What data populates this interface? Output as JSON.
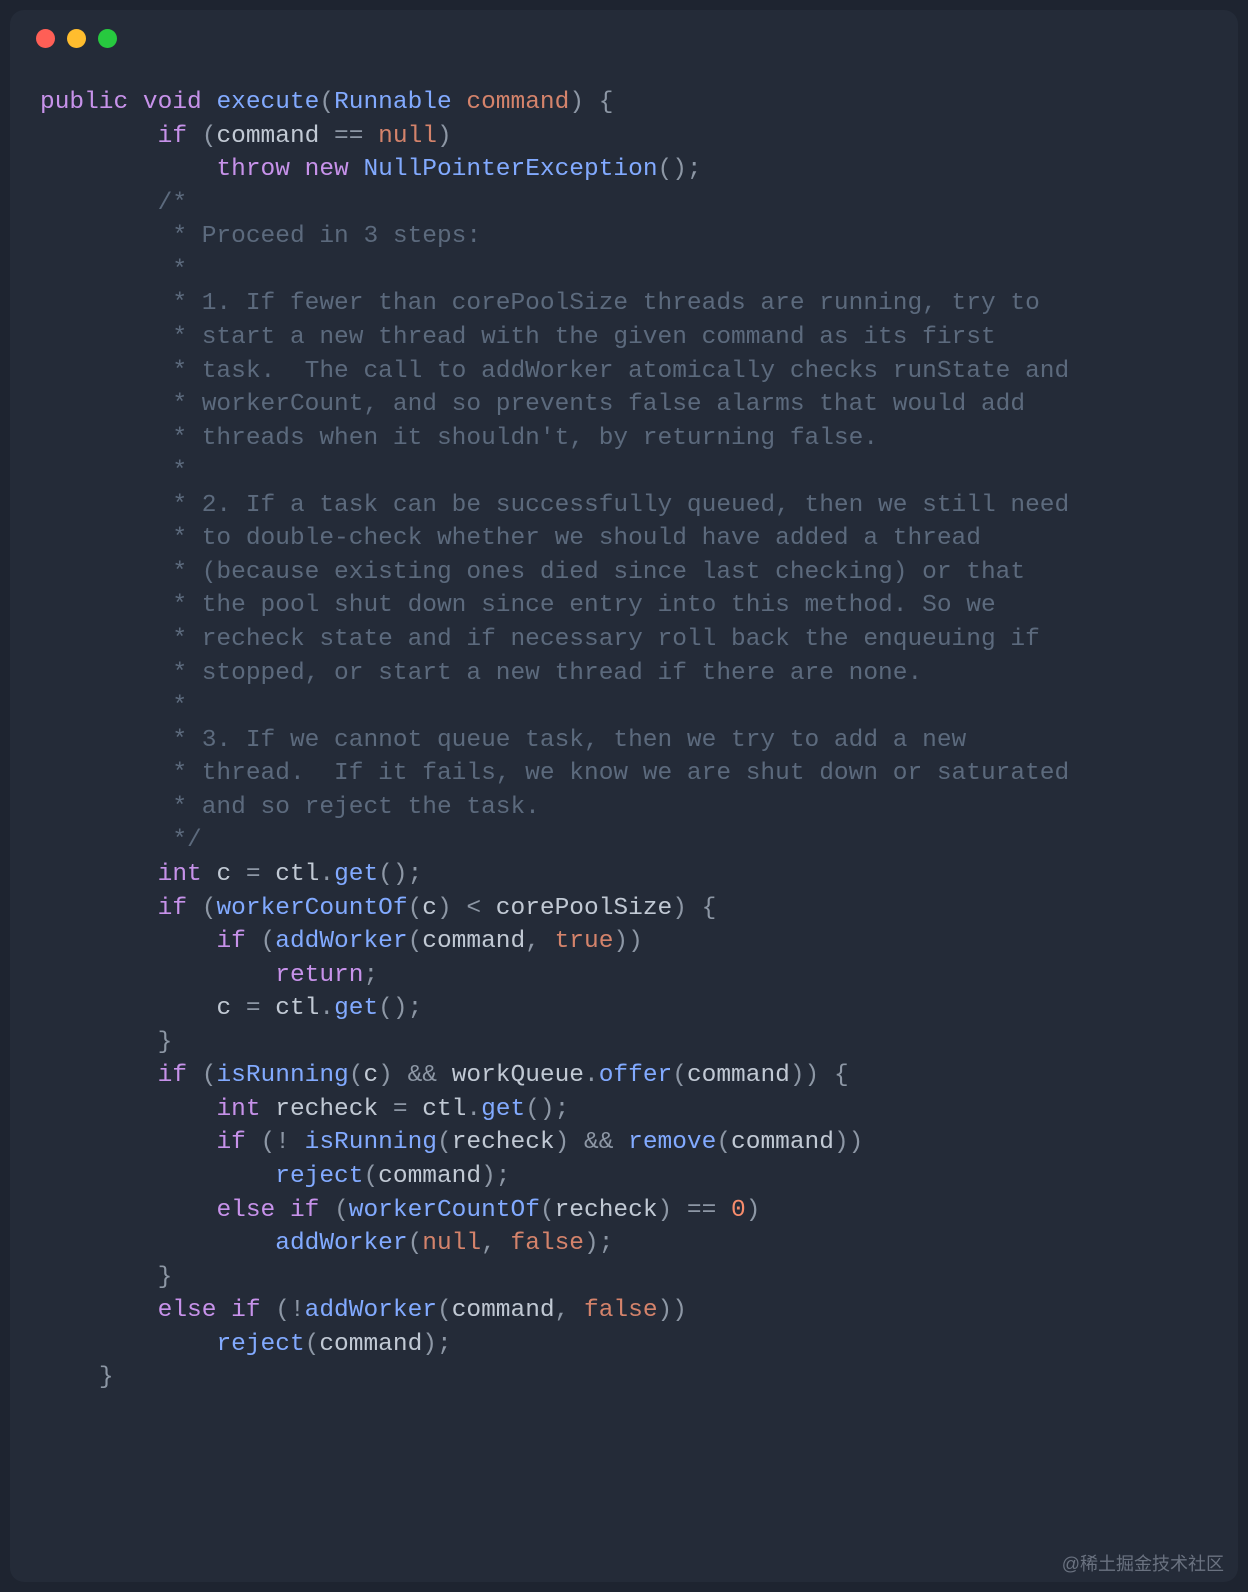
{
  "window": {
    "traffic_lights": [
      "red",
      "yellow",
      "green"
    ]
  },
  "watermark": "@稀土掘金技术社区",
  "code": {
    "line01": {
      "kw1": "public",
      "kw2": "void",
      "method": "execute",
      "p1": "(",
      "type": "Runnable",
      "sp": " ",
      "arg": "command",
      "p2": ")",
      "sp2": " ",
      "brace": "{"
    },
    "line02": {
      "indent": "        ",
      "kw": "if",
      "sp": " ",
      "p1": "(",
      "ident": "command",
      "op": " == ",
      "null": "null",
      "p2": ")"
    },
    "line03": {
      "indent": "            ",
      "kw1": "throw",
      "sp": " ",
      "kw2": "new",
      "sp2": " ",
      "type": "NullPointerException",
      "p": "();"
    },
    "line04": {
      "indent": "        ",
      "c": "/*"
    },
    "line05": {
      "indent": "         ",
      "c": "* Proceed in 3 steps:"
    },
    "line06": {
      "indent": "         ",
      "c": "*"
    },
    "line07": {
      "indent": "         ",
      "c": "* 1. If fewer than corePoolSize threads are running, try to"
    },
    "line08": {
      "indent": "         ",
      "c": "* start a new thread with the given command as its first"
    },
    "line09": {
      "indent": "         ",
      "c": "* task.  The call to addWorker atomically checks runState and"
    },
    "line10": {
      "indent": "         ",
      "c": "* workerCount, and so prevents false alarms that would add"
    },
    "line11": {
      "indent": "         ",
      "c": "* threads when it shouldn't, by returning false."
    },
    "line12": {
      "indent": "         ",
      "c": "*"
    },
    "line13": {
      "indent": "         ",
      "c": "* 2. If a task can be successfully queued, then we still need"
    },
    "line14": {
      "indent": "         ",
      "c": "* to double-check whether we should have added a thread"
    },
    "line15": {
      "indent": "         ",
      "c": "* (because existing ones died since last checking) or that"
    },
    "line16": {
      "indent": "         ",
      "c": "* the pool shut down since entry into this method. So we"
    },
    "line17": {
      "indent": "         ",
      "c": "* recheck state and if necessary roll back the enqueuing if"
    },
    "line18": {
      "indent": "         ",
      "c": "* stopped, or start a new thread if there are none."
    },
    "line19": {
      "indent": "         ",
      "c": "*"
    },
    "line20": {
      "indent": "         ",
      "c": "* 3. If we cannot queue task, then we try to add a new"
    },
    "line21": {
      "indent": "         ",
      "c": "* thread.  If it fails, we know we are shut down or saturated"
    },
    "line22": {
      "indent": "         ",
      "c": "* and so reject the task."
    },
    "line23": {
      "indent": "         ",
      "c": "*/"
    },
    "line24": {
      "indent": "        ",
      "int": "int",
      "sp": " ",
      "var": "c",
      "eq": " = ",
      "obj": "ctl",
      "dot": ".",
      "m": "get",
      "p": "();"
    },
    "line25": {
      "indent": "        ",
      "kw": "if",
      "sp": " ",
      "p1": "(",
      "m": "workerCountOf",
      "p2": "(",
      "var": "c",
      "p3": ")",
      "op": " < ",
      "ident": "corePoolSize",
      "p4": ")",
      "sp2": " ",
      "brace": "{"
    },
    "line26": {
      "indent": "            ",
      "kw": "if",
      "sp": " ",
      "p1": "(",
      "m": "addWorker",
      "p2": "(",
      "arg": "command",
      "comma": ", ",
      "bool": "true",
      "p3": "))"
    },
    "line27": {
      "indent": "                ",
      "kw": "return",
      "p": ";"
    },
    "line28": {
      "indent": "            ",
      "var": "c",
      "eq": " = ",
      "obj": "ctl",
      "dot": ".",
      "m": "get",
      "p": "();"
    },
    "line29": {
      "indent": "        ",
      "brace": "}"
    },
    "line30": {
      "indent": "        ",
      "kw": "if",
      "sp": " ",
      "p1": "(",
      "m1": "isRunning",
      "p2": "(",
      "var": "c",
      "p3": ")",
      "op": " && ",
      "obj": "workQueue",
      "dot": ".",
      "m2": "offer",
      "p4": "(",
      "arg": "command",
      "p5": "))",
      "sp2": " ",
      "brace": "{"
    },
    "line31": {
      "indent": "            ",
      "int": "int",
      "sp": " ",
      "var": "recheck",
      "eq": " = ",
      "obj": "ctl",
      "dot": ".",
      "m": "get",
      "p": "();"
    },
    "line32": {
      "indent": "            ",
      "kw": "if",
      "sp": " ",
      "p1": "(! ",
      "m1": "isRunning",
      "p2": "(",
      "var": "recheck",
      "p3": ")",
      "op": " && ",
      "m2": "remove",
      "p4": "(",
      "arg": "command",
      "p5": "))"
    },
    "line33": {
      "indent": "                ",
      "m": "reject",
      "p1": "(",
      "arg": "command",
      "p2": ");"
    },
    "line34": {
      "indent": "            ",
      "kw": "else",
      "sp": " ",
      "kw2": "if",
      "sp2": " ",
      "p1": "(",
      "m": "workerCountOf",
      "p2": "(",
      "var": "recheck",
      "p3": ")",
      "op": " == ",
      "num": "0",
      "p4": ")"
    },
    "line35": {
      "indent": "                ",
      "m": "addWorker",
      "p1": "(",
      "null": "null",
      "comma": ", ",
      "bool": "false",
      "p2": ");"
    },
    "line36": {
      "indent": "        ",
      "brace": "}"
    },
    "line37": {
      "indent": "        ",
      "kw": "else",
      "sp": " ",
      "kw2": "if",
      "sp2": " ",
      "p1": "(!",
      "m": "addWorker",
      "p2": "(",
      "arg": "command",
      "comma": ", ",
      "bool": "false",
      "p3": "))"
    },
    "line38": {
      "indent": "            ",
      "m": "reject",
      "p1": "(",
      "arg": "command",
      "p2": ");"
    },
    "line39": {
      "indent": "    ",
      "brace": "}"
    }
  }
}
